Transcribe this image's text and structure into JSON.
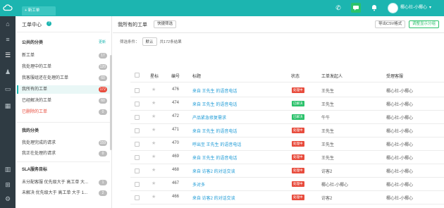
{
  "topbar": {
    "new_tab_label": "+ 新工单",
    "user_name": "椰心社-小椰心"
  },
  "sidebar": {
    "title": "工单中心",
    "section_public": "公共的分类",
    "section_public_action": "更新",
    "public_items": [
      {
        "label": "新工单",
        "count": "17",
        "hot": false,
        "red": false,
        "selected": false
      },
      {
        "label": "我处理中的工单",
        "count": "120",
        "hot": false,
        "red": false,
        "selected": false
      },
      {
        "label": "我客服组还在处理的工单",
        "count": "60",
        "hot": false,
        "red": false,
        "selected": false
      },
      {
        "label": "我所有的工单",
        "count": "172",
        "hot": true,
        "red": false,
        "selected": true
      },
      {
        "label": "已经解决的工单",
        "count": "60",
        "hot": false,
        "red": false,
        "selected": false
      },
      {
        "label": "已删除的工单",
        "count": "0",
        "hot": false,
        "red": true,
        "selected": false
      }
    ],
    "section_mine": "我的分类",
    "mine_items": [
      {
        "label": "我处理完成的请求",
        "count": "159"
      },
      {
        "label": "我正在处理的请求",
        "count": "0"
      }
    ],
    "section_sla": "SLA服务目标",
    "sla_items": [
      {
        "label": "未分配客服 优先级大于 高工单 大...",
        "count": "1"
      },
      {
        "label": "未解决 优先级大于 高工单 大于 1...",
        "count": "2"
      }
    ]
  },
  "main": {
    "title": "我所有的工单",
    "quick_filter": "快捷筛选",
    "export_btn": "导出CSV格式",
    "group_btn": "调整显示分组",
    "filter_label": "筛选条件：",
    "filter_chip": "默认",
    "filter_result": "共172条结果",
    "columns": [
      "星标",
      "编号",
      "标题",
      "状态",
      "工单发起人",
      "受理客服"
    ],
    "rows": [
      {
        "id": "476",
        "title": "来自 王先生 的语音电话",
        "status": "处理中",
        "status_color": "#e84c3d",
        "requester": "王先生",
        "agent": "椰心社-小椰心"
      },
      {
        "id": "474",
        "title": "来自 王先生 的语音电话",
        "status": "已解决",
        "status_color": "#2bc26b",
        "requester": "王先生",
        "agent": "椰心社-小椰心"
      },
      {
        "id": "472",
        "title": "产品紧急修复需求",
        "status": "已解决",
        "status_color": "#2bc26b",
        "requester": "牛牛",
        "agent": "椰心社-小椰心"
      },
      {
        "id": "471",
        "title": "来自 王先生 的语音电话",
        "status": "处理中",
        "status_color": "#e84c3d",
        "requester": "王先生",
        "agent": "椰心社-小椰心"
      },
      {
        "id": "470",
        "title": "呼出至 王先生 的语音电话",
        "status": "处理中",
        "status_color": "#e84c3d",
        "requester": "王先生",
        "agent": "椰心社-小椰心"
      },
      {
        "id": "469",
        "title": "来自 王先生 的语音电话",
        "status": "处理中",
        "status_color": "#e84c3d",
        "requester": "王先生",
        "agent": "椰心社-小椰心"
      },
      {
        "id": "468",
        "title": "来自 访客2 的对话交谈",
        "status": "处理中",
        "status_color": "#e84c3d",
        "requester": "访客2",
        "agent": "椰心社-小椰心"
      },
      {
        "id": "467",
        "title": "多对多",
        "status": "处理中",
        "status_color": "#e84c3d",
        "requester": "椰心社-小椰心",
        "agent": "椰心社-小椰心"
      },
      {
        "id": "466",
        "title": "来自 访客2 的对话交谈",
        "status": "处理中",
        "status_color": "#e84c3d",
        "requester": "访客2",
        "agent": "椰心社-小椰心"
      }
    ]
  }
}
